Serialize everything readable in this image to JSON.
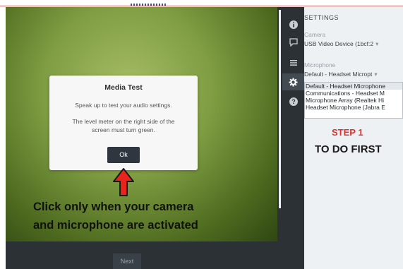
{
  "settings": {
    "title": "SETTINGS",
    "camera_label": "Camera",
    "camera_value": "USB Video Device (1bcf:2",
    "microphone_label": "Microphone",
    "microphone_value": "Default - Headset Micropt",
    "microphone_options": [
      "Default - Headset Microphone",
      "Communications - Headset M",
      "Microphone Array (Realtek Hi",
      "Headset Microphone (Jabra E"
    ]
  },
  "sidebar": {
    "icons": [
      "info-icon",
      "chat-icon",
      "list-icon",
      "gear-icon",
      "help-icon"
    ]
  },
  "modal": {
    "title": "Media Test",
    "text1": "Speak up to test your audio settings.",
    "text2": "The level meter on the right side of the screen must turn green.",
    "ok_label": "Ok"
  },
  "bottom": {
    "next_label": "Next"
  },
  "annotations": {
    "step": "STEP 1",
    "todo": "TO DO FIRST",
    "note_line1": "Click only when your camera",
    "note_line2": "and microphone are activated"
  },
  "colors": {
    "sidebar": "#2c3136",
    "settings_bg": "#eef1f4",
    "annotation_red": "#e0302a",
    "arrow_red": "#e8241c"
  }
}
